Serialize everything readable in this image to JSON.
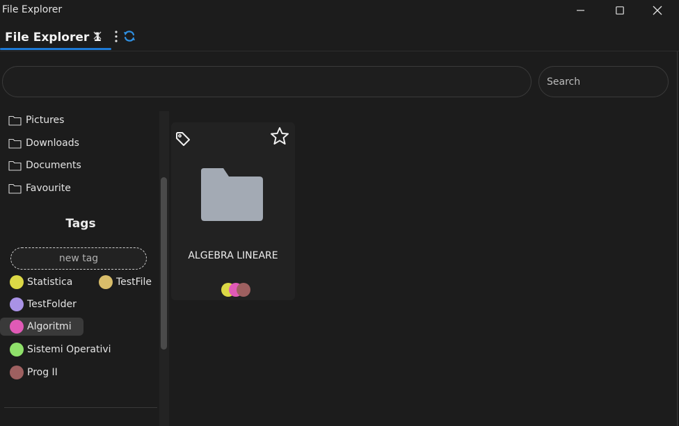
{
  "window": {
    "title": "File Explorer"
  },
  "tabs": [
    {
      "label": "File Explorer 1"
    }
  ],
  "path": {
    "value": ""
  },
  "search": {
    "placeholder": "Search"
  },
  "sidebar": {
    "places": [
      {
        "label": "Pictures",
        "icon": "folder-icon"
      },
      {
        "label": "Downloads",
        "icon": "folder-icon"
      },
      {
        "label": "Documents",
        "icon": "folder-icon"
      },
      {
        "label": "Favourite",
        "icon": "folder-icon"
      }
    ],
    "tags_title": "Tags",
    "new_tag_placeholder": "new tag",
    "tags": [
      {
        "label": "Statistica",
        "color": "#dcd846"
      },
      {
        "label": "TestFile",
        "color": "#d9bd6a"
      },
      {
        "label": "TestFolder",
        "color": "#a992e6"
      },
      {
        "label": "Algoritmi",
        "color": "#e05ab6",
        "selected": true
      },
      {
        "label": "Sistemi Operativi",
        "color": "#8fe06a"
      },
      {
        "label": "Prog II",
        "color": "#9e6060"
      }
    ]
  },
  "content": {
    "items": [
      {
        "name": "ALGEBRA LINEARE",
        "type": "folder",
        "tag_colors": [
          "#dcd846",
          "#e05ab6",
          "#9e6060"
        ]
      }
    ]
  },
  "colors": {
    "accent": "#1e7ad6",
    "refresh_icon": "#2f8fe0",
    "folder": "#a3aab4"
  }
}
